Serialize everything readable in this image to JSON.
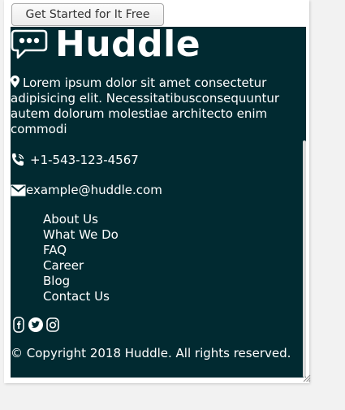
{
  "cta": {
    "label": "Get Started for It Free"
  },
  "footer": {
    "brand": "Huddle",
    "about": "Lorem ipsum dolor sit amet consectetur adipisicing elit. Necessitatibusconsequuntur autem dolorum molestiae architecto enim commodi",
    "phone": "+1-543-123-4567",
    "email": "example@huddle.com",
    "nav": [
      {
        "label": "About Us"
      },
      {
        "label": "What We Do"
      },
      {
        "label": "FAQ"
      },
      {
        "label": "Career"
      },
      {
        "label": "Blog"
      },
      {
        "label": "Contact Us"
      }
    ],
    "social": [
      {
        "icon": "facebook-icon"
      },
      {
        "icon": "twitter-icon"
      },
      {
        "icon": "instagram-icon"
      }
    ],
    "copyright": "© Copyright 2018 Huddle. All rights reserved."
  },
  "colors": {
    "footer_bg": "#012a31",
    "text": "#ffffff",
    "button_border": "#a9a9a9"
  }
}
